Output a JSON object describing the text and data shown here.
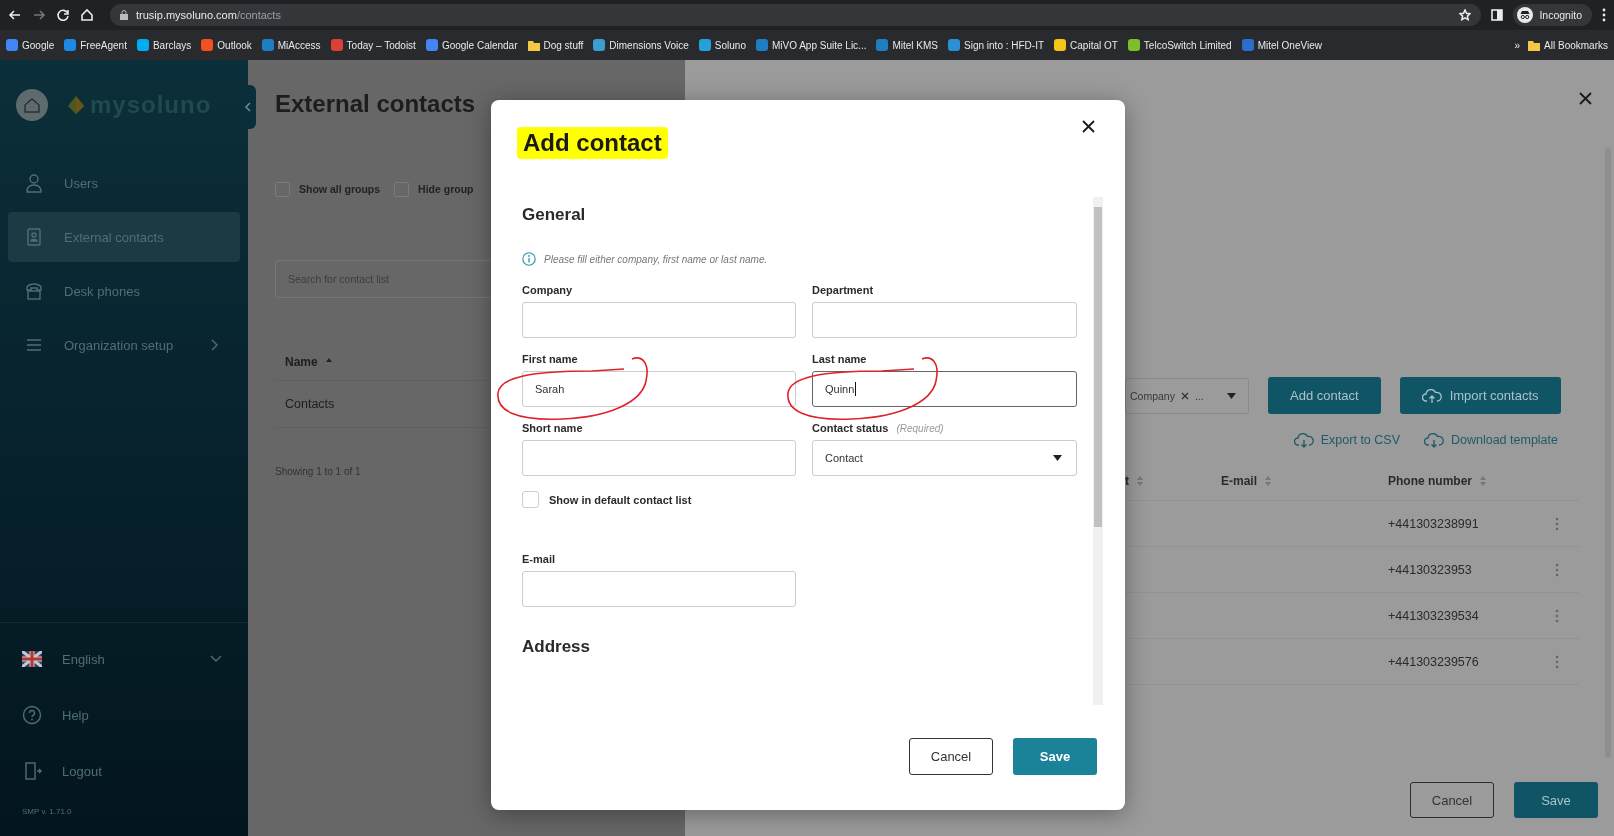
{
  "browser": {
    "url_host": "trusip.mysoluno.com",
    "url_path": "/contacts",
    "profile": "Incognito",
    "bookmarks": [
      {
        "label": "Google",
        "kind": "site",
        "color": "#4285f4"
      },
      {
        "label": "FreeAgent",
        "kind": "site",
        "color": "#1e88e5"
      },
      {
        "label": "Barclays",
        "kind": "site",
        "color": "#00aeef"
      },
      {
        "label": "Outlook",
        "kind": "site",
        "color": "#f25022"
      },
      {
        "label": "MiAccess",
        "kind": "site",
        "color": "#1d7fc1"
      },
      {
        "label": "Today – Todoist",
        "kind": "site",
        "color": "#db4035"
      },
      {
        "label": "Google Calendar",
        "kind": "site",
        "color": "#4285f4"
      },
      {
        "label": "Dog stuff",
        "kind": "folder",
        "color": "#f6c744"
      },
      {
        "label": "Dimensions Voice",
        "kind": "site",
        "color": "#3a9fcf"
      },
      {
        "label": "Soluno",
        "kind": "site",
        "color": "#25a0d8"
      },
      {
        "label": "MiVO App Suite Lic...",
        "kind": "site",
        "color": "#1d7fc1"
      },
      {
        "label": "Mitel KMS",
        "kind": "site",
        "color": "#1d7fc1"
      },
      {
        "label": "Sign into : HFD-IT",
        "kind": "site",
        "color": "#2b8fd6"
      },
      {
        "label": "Capital OT",
        "kind": "site",
        "color": "#f5c518"
      },
      {
        "label": "TelcoSwitch Limited",
        "kind": "site",
        "color": "#7cbf2a"
      },
      {
        "label": "Mitel OneView",
        "kind": "site",
        "color": "#2a6fc9"
      }
    ],
    "overflow": "»",
    "all_bookmarks": "All Bookmarks"
  },
  "sidebar": {
    "logo": "mysoluno",
    "nav": [
      {
        "label": "Users",
        "selected": false,
        "submenu": false
      },
      {
        "label": "External contacts",
        "selected": true,
        "submenu": false
      },
      {
        "label": "Desk phones",
        "selected": false,
        "submenu": false
      },
      {
        "label": "Organization setup",
        "selected": false,
        "submenu": true
      }
    ],
    "language": "English",
    "help": "Help",
    "logout": "Logout",
    "version": "SMP v. 1.71.0"
  },
  "contact_lists": {
    "title": "External contacts",
    "checkboxes": [
      {
        "label": "Show all groups",
        "checked": false
      },
      {
        "label": "Hide group",
        "checked": false
      }
    ],
    "search": {
      "placeholder": "Search for contact list"
    },
    "column": "Name",
    "rows": [
      "Contacts"
    ],
    "footer": "Showing 1 to 1 of 1"
  },
  "edit_panel": {
    "filter": {
      "chip": "Company",
      "more": "..."
    },
    "buttons": [
      {
        "label": "Add contact"
      },
      {
        "label": "Import contacts"
      }
    ],
    "links": [
      "Export to CSV",
      "Download template"
    ],
    "columns": [
      "t",
      "E-mail",
      "Phone number"
    ],
    "rows": [
      [
        "",
        "",
        "+441303238991"
      ],
      [
        "",
        "",
        "+44130323953"
      ],
      [
        "",
        "",
        "+441303239534"
      ],
      [
        "",
        "",
        "+441303239576"
      ]
    ],
    "footer_buttons": [
      {
        "label": "Cancel",
        "kind": "secondary"
      },
      {
        "label": "Save",
        "kind": "primary"
      }
    ]
  },
  "modal": {
    "title": "Add contact",
    "title_highlighted": true,
    "section": "General",
    "note": "Please fill either company, first name or last name.",
    "fields": [
      {
        "kind": "text",
        "label": "Company",
        "focused": false,
        "circled": false
      },
      {
        "kind": "text",
        "label": "Department",
        "focused": false,
        "circled": false
      },
      {
        "kind": "text",
        "label": "First name",
        "value": "Sarah",
        "focused": false,
        "circled": true
      },
      {
        "kind": "text",
        "label": "Last name",
        "value": "Quinn",
        "focused": true,
        "circled": true
      },
      {
        "kind": "text",
        "label": "Short name",
        "focused": false,
        "circled": false
      },
      {
        "kind": "select",
        "label": "Contact status",
        "note": "(Required)",
        "value": "Contact",
        "focused": false,
        "circled": false
      },
      {
        "kind": "checkbox",
        "label": "Show in default contact list",
        "checked": false
      },
      {
        "kind": "text",
        "label": "E-mail",
        "focused": false,
        "circled": false
      }
    ],
    "next_section": "Address",
    "buttons": [
      {
        "label": "Cancel",
        "kind": "secondary"
      },
      {
        "label": "Save",
        "kind": "primary"
      }
    ]
  }
}
